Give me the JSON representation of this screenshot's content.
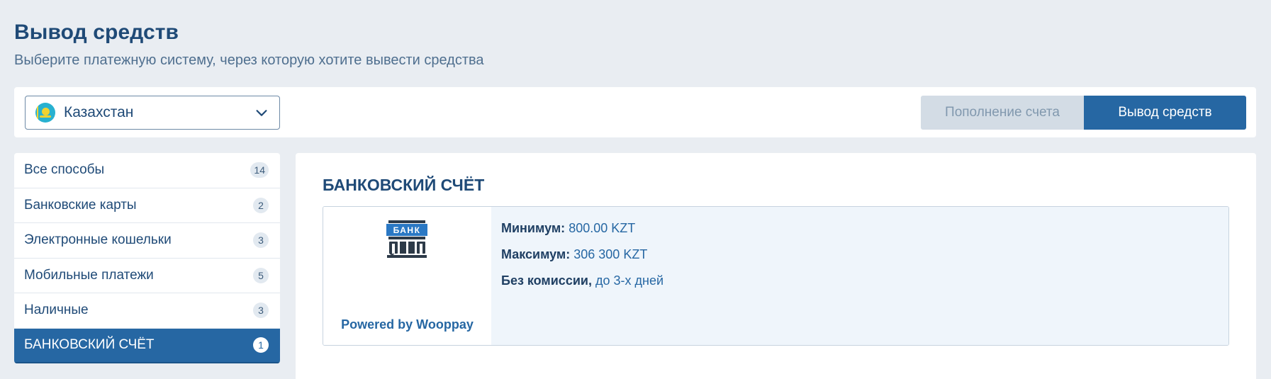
{
  "header": {
    "title": "Вывод средств",
    "subtitle": "Выберите платежную систему, через которую хотите вывести средства"
  },
  "country_select": {
    "selected": "Казахстан",
    "flag_icon": "kazakhstan-flag-icon"
  },
  "tabs": [
    {
      "label": "Пополнение счета",
      "active": false
    },
    {
      "label": "Вывод средств",
      "active": true
    }
  ],
  "sidebar": {
    "items": [
      {
        "label": "Все способы",
        "count": "14",
        "active": false
      },
      {
        "label": "Банковские карты",
        "count": "2",
        "active": false
      },
      {
        "label": "Электронные кошельки",
        "count": "3",
        "active": false
      },
      {
        "label": "Мобильные платежи",
        "count": "5",
        "active": false
      },
      {
        "label": "Наличные",
        "count": "3",
        "active": false
      },
      {
        "label": "БАНКОВСКИЙ СЧЁТ",
        "count": "1",
        "active": true
      }
    ]
  },
  "main": {
    "section_title": "БАНКОВСКИЙ СЧЁТ",
    "method": {
      "logo_text": "БАНК",
      "powered_by": "Powered by Wooppay",
      "min_label": "Минимум:",
      "min_value": "800.00 KZT",
      "max_label": "Максимум:",
      "max_value": "306 300 KZT",
      "fee_label": "Без комиссии,",
      "fee_value": "до 3-х дней"
    }
  },
  "colors": {
    "page_bg": "#e9edf2",
    "primary": "#2667a3",
    "title": "#1f4a77",
    "inactive_tab": "#d3dce5",
    "card_info_bg": "#eff5fb"
  }
}
